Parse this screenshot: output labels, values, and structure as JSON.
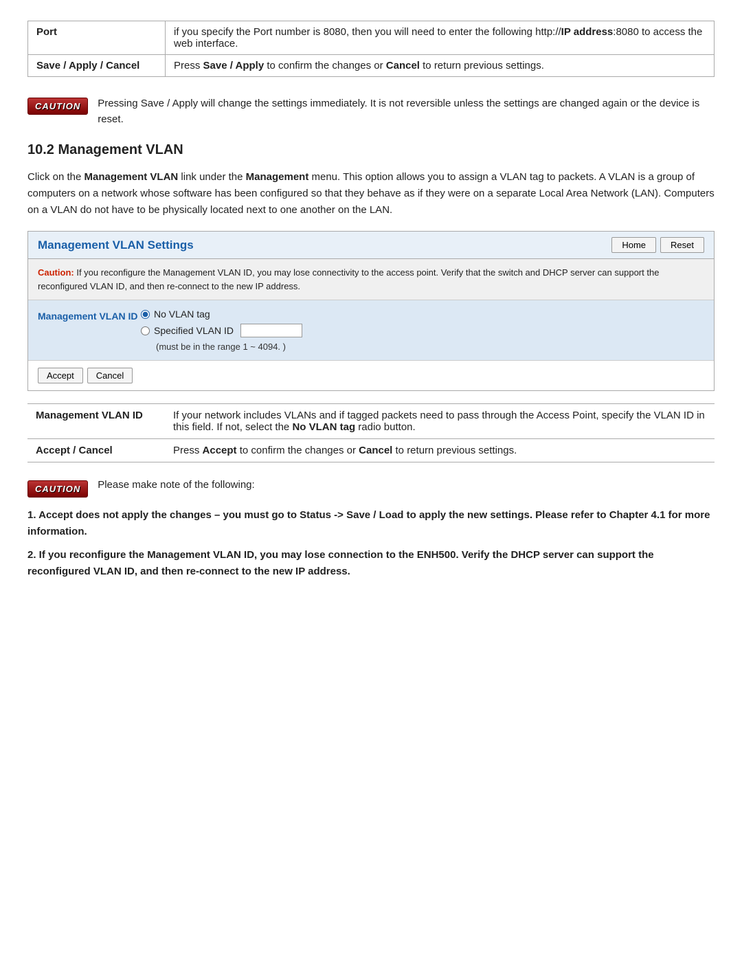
{
  "top_table": {
    "rows": [
      {
        "label": "Port",
        "content_plain": "if you specify the Port number is 8080, then you will need to enter the following http://",
        "content_bold": "IP address",
        "content_after": ":8080 to access the web interface."
      },
      {
        "label": "Save / Apply / Cancel",
        "content_prefix": "Press ",
        "content_bold": "Save / Apply",
        "content_middle": " to confirm the changes or ",
        "content_bold2": "Cancel",
        "content_after": " to return previous settings."
      }
    ]
  },
  "caution_badge_text": "CAUTION",
  "caution1_text": "Pressing Save / Apply will change the settings immediately. It is not reversible unless the settings are changed again or the device is reset.",
  "section_heading": "10.2 Management VLAN",
  "body_para": "Click on the Management VLAN link under the Management menu. This option allows you to assign a VLAN tag to packets. A VLAN is a group of computers on a network whose software has been configured so that they behave as if they were on a separate Local Area Network (LAN). Computers on a VLAN do not have to be physically located next to one another on the LAN.",
  "panel": {
    "title": "Management VLAN Settings",
    "btn_home": "Home",
    "btn_reset": "Reset",
    "caution_inner": {
      "label": "Caution:",
      "text": " If you reconfigure the Management VLAN ID, you may lose connectivity to the access point. Verify that the switch and DHCP server can support the reconfigured VLAN ID, and then re-connect to the new IP address."
    },
    "vlan_label": "Management VLAN ID",
    "radio_no_vlan": "No VLAN tag",
    "radio_specified": "Specified VLAN ID",
    "vlan_range_note": "(must be in the range 1 ~ 4094. )",
    "accept_label": "Accept",
    "cancel_label": "Cancel"
  },
  "info_table": {
    "rows": [
      {
        "label": "Management VLAN ID",
        "content": "If your network includes VLANs and if tagged packets need to pass through the Access Point, specify the VLAN ID in this field. If not, select the ",
        "bold_part": "No VLAN tag",
        "after": " radio button."
      },
      {
        "label": "Accept / Cancel",
        "prefix": "Press ",
        "bold1": "Accept",
        "middle": " to confirm the changes or ",
        "bold2": "Cancel",
        "after": " to return previous settings."
      }
    ]
  },
  "caution2_text": "Please make note of the following:",
  "caution2_badge": "CAUTION",
  "numbered_items": [
    "1. Accept does not apply the changes – you must go to Status -> Save / Load to apply the new settings. Please refer to Chapter 4.1 for more information.",
    "2. If you reconfigure the Management VLAN ID, you may lose connection to the ENH500. Verify the DHCP server can support the reconfigured VLAN ID, and then re-connect to the new IP address."
  ]
}
